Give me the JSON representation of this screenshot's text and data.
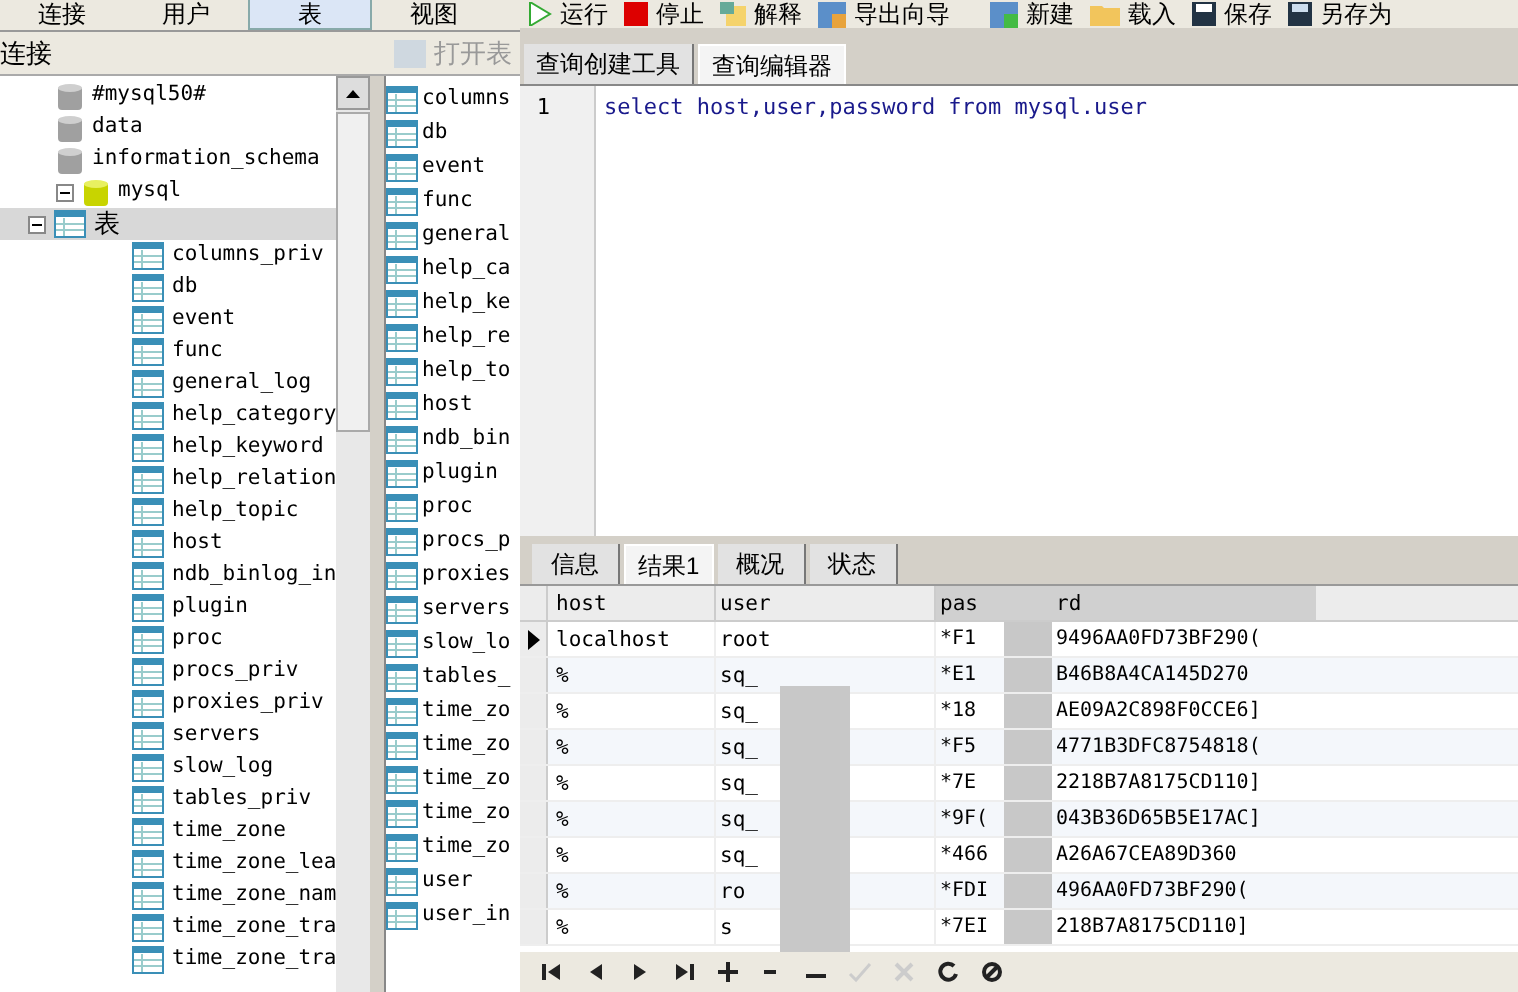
{
  "top_tabs": [
    {
      "label": "连接",
      "selected": false
    },
    {
      "label": "用户",
      "selected": false
    },
    {
      "label": "表",
      "selected": true
    },
    {
      "label": "视图",
      "selected": false
    }
  ],
  "left_header": "连接",
  "open_table_button": {
    "label": "打开表",
    "disabled": true
  },
  "tree": [
    {
      "label": "#mysql50#",
      "kind": "database",
      "active": false
    },
    {
      "label": "data",
      "kind": "database",
      "active": false
    },
    {
      "label": "information_schema",
      "kind": "database",
      "active": false
    },
    {
      "label": "mysql",
      "kind": "database",
      "active": true,
      "expanded": true,
      "children": [
        {
          "label": "表",
          "kind": "folder",
          "expanded": true,
          "selected": true,
          "children": [
            {
              "label": "columns_priv",
              "kind": "table"
            },
            {
              "label": "db",
              "kind": "table"
            },
            {
              "label": "event",
              "kind": "table"
            },
            {
              "label": "func",
              "kind": "table"
            },
            {
              "label": "general_log",
              "kind": "table"
            },
            {
              "label": "help_category",
              "kind": "table"
            },
            {
              "label": "help_keyword",
              "kind": "table"
            },
            {
              "label": "help_relation",
              "kind": "table"
            },
            {
              "label": "help_topic",
              "kind": "table"
            },
            {
              "label": "host",
              "kind": "table"
            },
            {
              "label": "ndb_binlog_in",
              "kind": "table"
            },
            {
              "label": "plugin",
              "kind": "table"
            },
            {
              "label": "proc",
              "kind": "table"
            },
            {
              "label": "procs_priv",
              "kind": "table"
            },
            {
              "label": "proxies_priv",
              "kind": "table"
            },
            {
              "label": "servers",
              "kind": "table"
            },
            {
              "label": "slow_log",
              "kind": "table"
            },
            {
              "label": "tables_priv",
              "kind": "table"
            },
            {
              "label": "time_zone",
              "kind": "table"
            },
            {
              "label": "time_zone_lea",
              "kind": "table"
            },
            {
              "label": "time_zone_nam",
              "kind": "table"
            },
            {
              "label": "time_zone_tra",
              "kind": "table"
            },
            {
              "label": "time_zone_tra",
              "kind": "table"
            }
          ]
        }
      ]
    }
  ],
  "table_list": [
    "columns",
    "db",
    "event",
    "func",
    "general",
    "help_ca",
    "help_ke",
    "help_re",
    "help_to",
    "host",
    "ndb_bin",
    "plugin",
    "proc",
    "procs_p",
    "proxies",
    "servers",
    "slow_lo",
    "tables_",
    "time_zo",
    "time_zo",
    "time_zo",
    "time_zo",
    "time_zo",
    "user",
    "user_in"
  ],
  "toolbar": [
    {
      "label": "运行",
      "kind": "play"
    },
    {
      "label": "停止",
      "kind": "stop"
    },
    {
      "label": "解释",
      "kind": "explain"
    },
    {
      "label": "导出向导",
      "kind": "export"
    },
    {
      "label": "新建",
      "kind": "new"
    },
    {
      "label": "载入",
      "kind": "folder"
    },
    {
      "label": "保存",
      "kind": "save"
    },
    {
      "label": "另存为",
      "kind": "saveas"
    }
  ],
  "editor_tabs": [
    {
      "label": "查询创建工具",
      "selected": false
    },
    {
      "label": "查询编辑器",
      "selected": true
    }
  ],
  "editor": {
    "lines": [
      {
        "number": "1",
        "code": "select host,user,password from mysql.user"
      }
    ]
  },
  "result_tabs": [
    {
      "label": "信息",
      "selected": false
    },
    {
      "label": "结果1",
      "selected": true
    },
    {
      "label": "概况",
      "selected": false
    },
    {
      "label": "状态",
      "selected": false
    }
  ],
  "result_table": {
    "columns": [
      "host",
      "user",
      "pas",
      "rd"
    ],
    "rows": [
      {
        "host": "localhost",
        "user": "root",
        "password_start": "*F1",
        "password_end": "9496AA0FD73BF290(",
        "selected": true
      },
      {
        "host": "%",
        "user": "sq_",
        "password_start": "*E1",
        "password_end": "B46B8A4CA145D270",
        "selected": false
      },
      {
        "host": "%",
        "user": "sq_",
        "password_start": "*18",
        "password_end": "AE09A2C898F0CCE6]",
        "selected": false
      },
      {
        "host": "%",
        "user": "sq_",
        "password_start": "*F5",
        "password_end": "4771B3DFC8754818(",
        "selected": false
      },
      {
        "host": "%",
        "user": "sq_",
        "password_start": "*7E",
        "password_end": "2218B7A8175CD110]",
        "selected": false
      },
      {
        "host": "%",
        "user": "sq_",
        "password_start": "*9F(",
        "password_end": "043B36D65B5E17AC]",
        "selected": false
      },
      {
        "host": "%",
        "user": "sq_",
        "password_start": "*466",
        "password_end": "A26A67CEA89D360",
        "selected": false
      },
      {
        "host": "%",
        "user": "ro",
        "password_start": "*FDI",
        "password_end": "496AA0FD73BF290(",
        "selected": false
      },
      {
        "host": "%",
        "user": "s",
        "password_start": "*7EI",
        "password_end": "218B7A8175CD110]",
        "selected": false
      }
    ]
  },
  "nav_buttons": [
    {
      "kind": "first",
      "disabled": false
    },
    {
      "kind": "prev",
      "disabled": false
    },
    {
      "kind": "next",
      "disabled": false
    },
    {
      "kind": "last",
      "disabled": false
    },
    {
      "kind": "add",
      "disabled": false
    },
    {
      "kind": "remove",
      "disabled": false
    },
    {
      "kind": "minus",
      "disabled": false
    },
    {
      "kind": "check",
      "disabled": true
    },
    {
      "kind": "cancel",
      "disabled": true
    },
    {
      "kind": "refresh",
      "disabled": false
    },
    {
      "kind": "stop",
      "disabled": false
    }
  ]
}
